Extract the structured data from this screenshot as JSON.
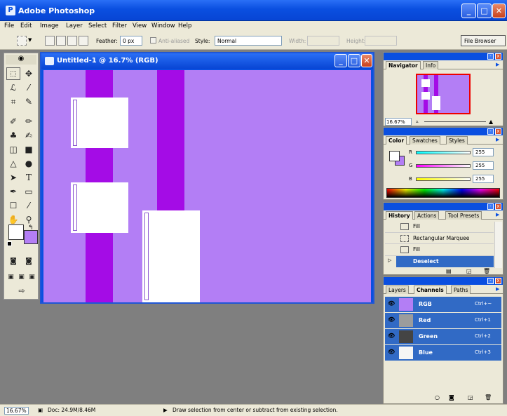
{
  "window": {
    "title": "Adobe Photoshop"
  },
  "menu": [
    "File",
    "Edit",
    "Image",
    "Layer",
    "Select",
    "Filter",
    "View",
    "Window",
    "Help"
  ],
  "options": {
    "feather_label": "Feather:",
    "feather_value": "0 px",
    "antialiased_label": "Anti-aliased",
    "style_label": "Style:",
    "style_value": "Normal",
    "width_label": "Width:",
    "height_label": "Height:",
    "file_browser": "File Browser"
  },
  "document": {
    "title": "Untitled-1 @ 16.7% (RGB)"
  },
  "navigator": {
    "tabs": [
      "Navigator",
      "Info"
    ],
    "zoom": "16.67%"
  },
  "color": {
    "tabs": [
      "Color",
      "Swatches",
      "Styles"
    ],
    "channels": [
      {
        "label": "R",
        "value": "255"
      },
      {
        "label": "G",
        "value": "255"
      },
      {
        "label": "B",
        "value": "255"
      }
    ]
  },
  "history": {
    "tabs": [
      "History",
      "Actions",
      "Tool Presets"
    ],
    "items": [
      "Fill",
      "Rectangular Marquee",
      "Fill",
      "Deselect"
    ]
  },
  "layers": {
    "tabs": [
      "Layers",
      "Channels",
      "Paths"
    ],
    "channels": [
      {
        "name": "RGB",
        "shortcut": "Ctrl+~"
      },
      {
        "name": "Red",
        "shortcut": "Ctrl+1"
      },
      {
        "name": "Green",
        "shortcut": "Ctrl+2"
      },
      {
        "name": "Blue",
        "shortcut": "Ctrl+3"
      }
    ]
  },
  "status": {
    "zoom": "16.67%",
    "doc": "Doc: 24.9M/8.46M",
    "hint": "Draw selection from center or subtract from existing selection."
  },
  "colors": {
    "canvas": "#b37ef5",
    "stripe": "#a40ce6",
    "titlebar": "#0a4fe0"
  }
}
